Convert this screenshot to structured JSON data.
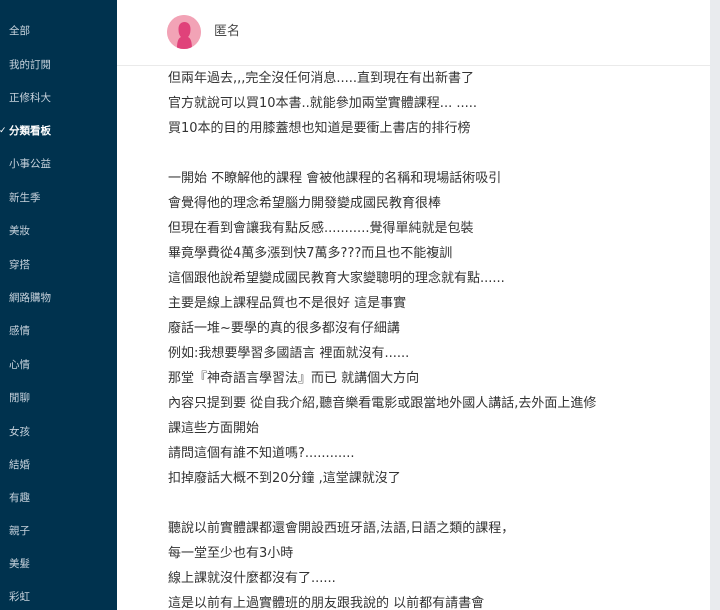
{
  "sidebar": {
    "items": [
      {
        "label": "全部",
        "active": false
      },
      {
        "label": "我的訂閱",
        "active": false
      },
      {
        "label": "正修科大",
        "active": false
      },
      {
        "label": "分類看板",
        "active": true
      },
      {
        "label": "小事公益",
        "active": false
      },
      {
        "label": "新生季",
        "active": false
      },
      {
        "label": "美妝",
        "active": false
      },
      {
        "label": "穿搭",
        "active": false
      },
      {
        "label": "網路購物",
        "active": false
      },
      {
        "label": "感情",
        "active": false
      },
      {
        "label": "心情",
        "active": false
      },
      {
        "label": "閒聊",
        "active": false
      },
      {
        "label": "女孩",
        "active": false
      },
      {
        "label": "結婚",
        "active": false
      },
      {
        "label": "有趣",
        "active": false
      },
      {
        "label": "親子",
        "active": false
      },
      {
        "label": "美髮",
        "active": false
      },
      {
        "label": "彩虹",
        "active": false
      }
    ]
  },
  "post": {
    "author": "匿名",
    "lines": [
      "但兩年過去,,,完全沒任何消息.....直到現在有出新書了",
      "官方就說可以買10本書..就能參加兩堂實體課程... .....",
      "買10本的目的用膝蓋想也知道是要衝上書店的排行榜",
      "",
      "一開始 不瞭解他的課程 會被他課程的名稱和現場話術吸引",
      "會覺得他的理念希望腦力開發變成國民教育很棒",
      "但現在看到會讓我有點反感...........覺得單純就是包裝",
      "畢竟學費從4萬多漲到快7萬多???而且也不能複訓",
      "這個跟他說希望變成國民教育大家變聰明的理念就有點......",
      "主要是線上課程品質也不是很好 這是事實",
      "廢話一堆~要學的真的很多都沒有仔細講",
      "例如:我想要學習多國語言 裡面就沒有......",
      "那堂『神奇語言學習法』而已 就講個大方向",
      "內容只提到要 從自我介紹,聽音樂看電影或跟當地外國人講話,去外面上進修",
      "課這些方面開始",
      "請問這個有誰不知道嗎?............",
      "扣掉廢話大概不到20分鐘 ,這堂課就沒了",
      "",
      "聽說以前實體課都還會開設西班牙語,法語,日語之類的課程，",
      "每一堂至少也有3小時",
      "線上課就沒什麼都沒有了......",
      "這是以前有上過實體班的朋友跟我說的 以前都有請書會"
    ]
  },
  "colors": {
    "sidebar_bg": "#00324e",
    "sidebar_text": "#c7d2dc",
    "avatar": "#f2a3b6",
    "page_bg": "#e9ebee"
  },
  "icons": {
    "avatar": "female-avatar-icon"
  }
}
